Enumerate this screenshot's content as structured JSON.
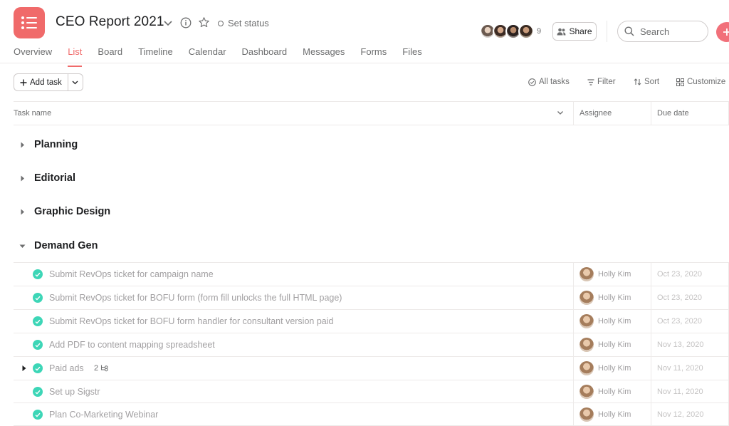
{
  "header": {
    "title": "CEO Report 2021",
    "set_status": "Set status",
    "member_count": "9",
    "share_label": "Share",
    "search_placeholder": "Search",
    "accent": "#f06a6a"
  },
  "tabs": [
    {
      "label": "Overview"
    },
    {
      "label": "List",
      "active": true
    },
    {
      "label": "Board"
    },
    {
      "label": "Timeline"
    },
    {
      "label": "Calendar"
    },
    {
      "label": "Dashboard"
    },
    {
      "label": "Messages"
    },
    {
      "label": "Forms"
    },
    {
      "label": "Files"
    }
  ],
  "toolbar": {
    "add_task": "Add task",
    "all_tasks": "All tasks",
    "filter": "Filter",
    "sort": "Sort",
    "customize": "Customize"
  },
  "columns": {
    "task_name": "Task name",
    "assignee": "Assignee",
    "due_date": "Due date"
  },
  "sections": [
    {
      "name": "Planning",
      "expanded": false
    },
    {
      "name": "Editorial",
      "expanded": false
    },
    {
      "name": "Graphic Design",
      "expanded": false
    },
    {
      "name": "Demand Gen",
      "expanded": true
    }
  ],
  "tasks": [
    {
      "name": "Submit RevOps ticket for campaign name",
      "assignee": "Holly Kim",
      "due": "Oct 23, 2020"
    },
    {
      "name": "Submit RevOps ticket for BOFU form (form fill unlocks the full HTML page)",
      "assignee": "Holly Kim",
      "due": "Oct 23, 2020"
    },
    {
      "name": "Submit RevOps ticket for BOFU form handler for consultant version paid",
      "assignee": "Holly Kim",
      "due": "Oct 23, 2020"
    },
    {
      "name": "Add PDF to content mapping spreadsheet",
      "assignee": "Holly Kim",
      "due": "Nov 13, 2020"
    },
    {
      "name": "Paid ads",
      "subtasks": "2",
      "assignee": "Holly Kim",
      "due": "Nov 11, 2020"
    },
    {
      "name": "Set up Sigstr",
      "assignee": "Holly Kim",
      "due": "Nov 11, 2020"
    },
    {
      "name": "Plan Co-Marketing Webinar",
      "assignee": "Holly Kim",
      "due": "Nov 12, 2020"
    }
  ]
}
